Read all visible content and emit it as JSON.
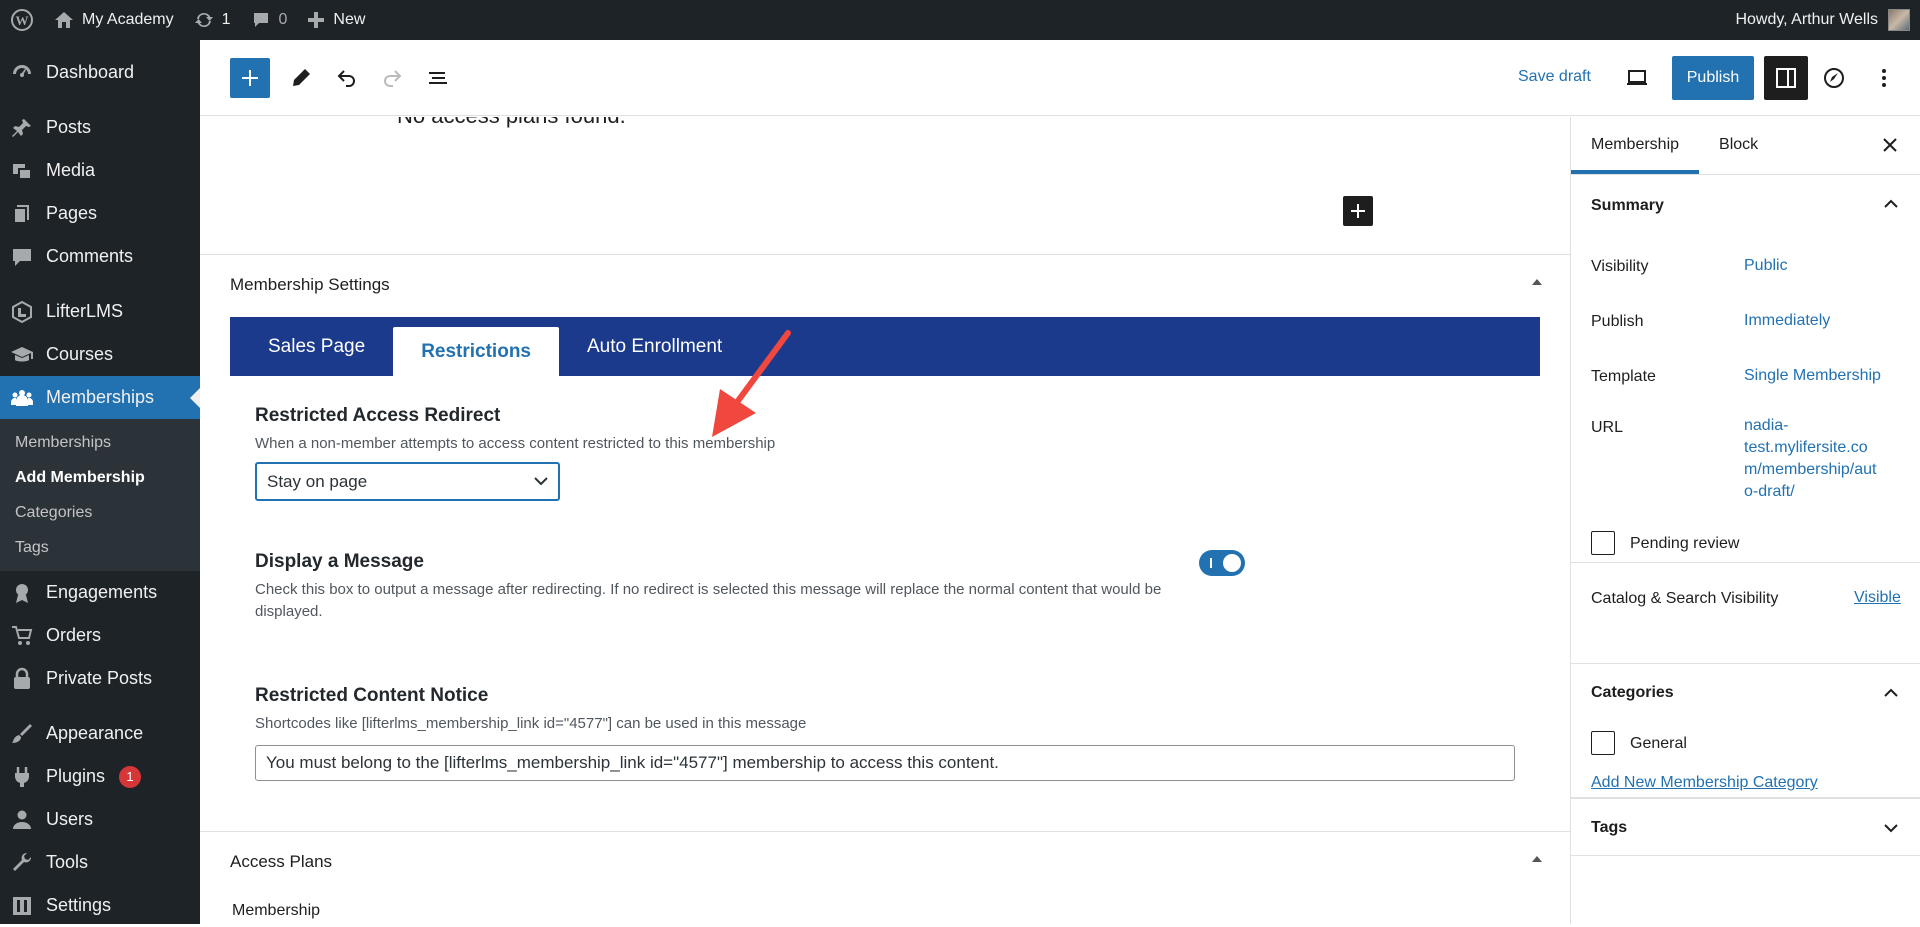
{
  "admin_bar": {
    "site_name": "My Academy",
    "updates_count": "1",
    "comments_count": "0",
    "new_label": "New",
    "greeting": "Howdy, Arthur Wells"
  },
  "sidebar": {
    "items": [
      {
        "label": "Dashboard",
        "icon": "dashboard-icon"
      },
      {
        "label": "Posts",
        "icon": "pin-icon"
      },
      {
        "label": "Media",
        "icon": "media-icon"
      },
      {
        "label": "Pages",
        "icon": "pages-icon"
      },
      {
        "label": "Comments",
        "icon": "comment-icon"
      },
      {
        "label": "LifterLMS",
        "icon": "lifterlms-icon"
      },
      {
        "label": "Courses",
        "icon": "graduation-cap-icon"
      },
      {
        "label": "Memberships",
        "icon": "groups-icon"
      },
      {
        "label": "Engagements",
        "icon": "awards-icon"
      },
      {
        "label": "Orders",
        "icon": "cart-icon"
      },
      {
        "label": "Private Posts",
        "icon": "lock-icon"
      },
      {
        "label": "Appearance",
        "icon": "brush-icon"
      },
      {
        "label": "Plugins",
        "icon": "plugin-icon",
        "badge": "1"
      },
      {
        "label": "Users",
        "icon": "user-icon"
      },
      {
        "label": "Tools",
        "icon": "wrench-icon"
      },
      {
        "label": "Settings",
        "icon": "settings-icon"
      }
    ],
    "submenu": [
      "Memberships",
      "Add Membership",
      "Categories",
      "Tags"
    ]
  },
  "header": {
    "save_draft": "Save draft",
    "publish": "Publish"
  },
  "content": {
    "no_plans": "No access plans found.",
    "settings_title": "Membership Settings",
    "tabs": [
      "Sales Page",
      "Restrictions",
      "Auto Enrollment"
    ],
    "redirect_label": "Restricted Access Redirect",
    "redirect_desc": "When a non-member attempts to access content restricted to this membership",
    "redirect_value": "Stay on page",
    "message_label": "Display a Message",
    "message_desc": "Check this box to output a message after redirecting. If no redirect is selected this message will replace the normal content that would be displayed.",
    "notice_label": "Restricted Content Notice",
    "notice_desc": "Shortcodes like [lifterlms_membership_link id=\"4577\"] can be used in this message",
    "notice_value": "You must belong to the [lifterlms_membership_link id=\"4577\"] membership to access this content.",
    "access_plans_title": "Access Plans",
    "breadcrumb": "Membership"
  },
  "right_sidebar": {
    "tabs": [
      "Membership",
      "Block"
    ],
    "summary_title": "Summary",
    "visibility_label": "Visibility",
    "visibility_value": "Public",
    "publish_label": "Publish",
    "publish_value": "Immediately",
    "template_label": "Template",
    "template_value": "Single Membership",
    "url_label": "URL",
    "url_value_lines": [
      "nadia-",
      "test.mylifersite.co",
      "m/membership/aut",
      "o-draft/"
    ],
    "pending_review": "Pending review",
    "catalog_label": "Catalog & Search Visibility",
    "catalog_value": "Visible",
    "categories_title": "Categories",
    "category_general": "General",
    "add_category": "Add New Membership Category",
    "tags_title": "Tags"
  },
  "colors": {
    "accent": "#2271b1",
    "admin_dark": "#1d2327",
    "tabs_bg": "#1b3a8c",
    "annotation_arrow": "#f0483e"
  }
}
